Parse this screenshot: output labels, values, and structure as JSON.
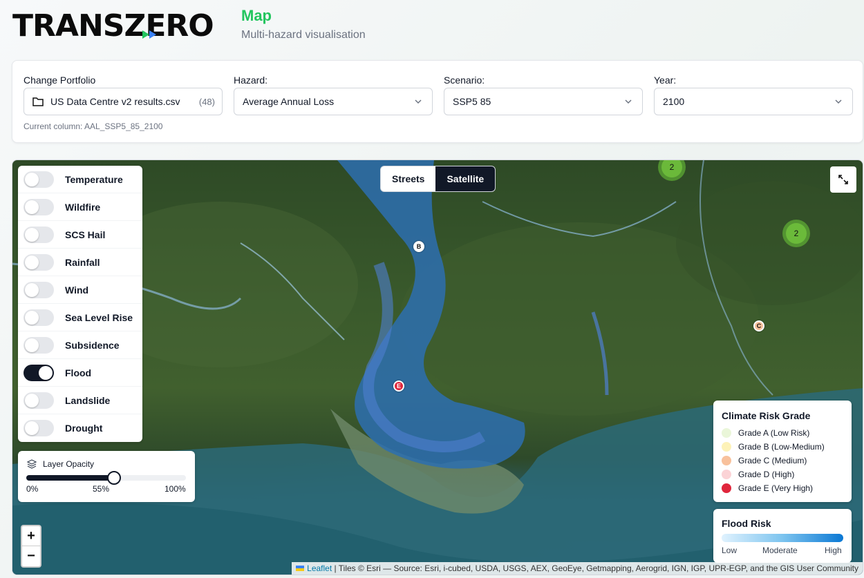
{
  "header": {
    "logo_text": "TRANSZERO",
    "title": "Map",
    "subtitle": "Multi-hazard visualisation"
  },
  "controls": {
    "portfolio_label": "Change Portfolio",
    "portfolio_value": "US Data Centre v2 results.csv",
    "portfolio_count": "(48)",
    "hazard_label": "Hazard:",
    "hazard_value": "Average Annual Loss",
    "scenario_label": "Scenario:",
    "scenario_value": "SSP5 85",
    "year_label": "Year:",
    "year_value": "2100",
    "current_column": "Current column: AAL_SSP5_85_2100"
  },
  "layers": [
    {
      "label": "Temperature",
      "on": false
    },
    {
      "label": "Wildfire",
      "on": false
    },
    {
      "label": "SCS Hail",
      "on": false
    },
    {
      "label": "Rainfall",
      "on": false
    },
    {
      "label": "Wind",
      "on": false
    },
    {
      "label": "Sea Level Rise",
      "on": false
    },
    {
      "label": "Subsidence",
      "on": false
    },
    {
      "label": "Flood",
      "on": true
    },
    {
      "label": "Landslide",
      "on": false
    },
    {
      "label": "Drought",
      "on": false
    }
  ],
  "opacity": {
    "title": "Layer Opacity",
    "value_percent": 55,
    "min_label": "0%",
    "mid_label": "55%",
    "max_label": "100%"
  },
  "basemap": {
    "streets": "Streets",
    "satellite": "Satellite",
    "active": "satellite"
  },
  "zoom": {
    "in": "+",
    "out": "−"
  },
  "markers": {
    "b": "B",
    "c": "C",
    "e": "E",
    "cluster_1": "2",
    "cluster_2": "2"
  },
  "risk_legend": {
    "title": "Climate Risk Grade",
    "items": [
      {
        "label": "Grade A (Low Risk)",
        "color": "#eaf6d9"
      },
      {
        "label": "Grade B (Low-Medium)",
        "color": "#fdf2b8"
      },
      {
        "label": "Grade C (Medium)",
        "color": "#f8c19c"
      },
      {
        "label": "Grade D (High)",
        "color": "#fbd3d6"
      },
      {
        "label": "Grade E (Very High)",
        "color": "#e0263c"
      }
    ]
  },
  "flood_legend": {
    "title": "Flood Risk",
    "low": "Low",
    "moderate": "Moderate",
    "high": "High"
  },
  "attribution": {
    "leaflet": "Leaflet",
    "text": "| Tiles © Esri — Source: Esri, i-cubed, USDA, USGS, AEX, GeoEye, Getmapping, Aerogrid, IGN, IGP, UPR-EGP, and the GIS User Community"
  },
  "colors": {
    "accent": "#22c55e",
    "dark": "#111827"
  }
}
